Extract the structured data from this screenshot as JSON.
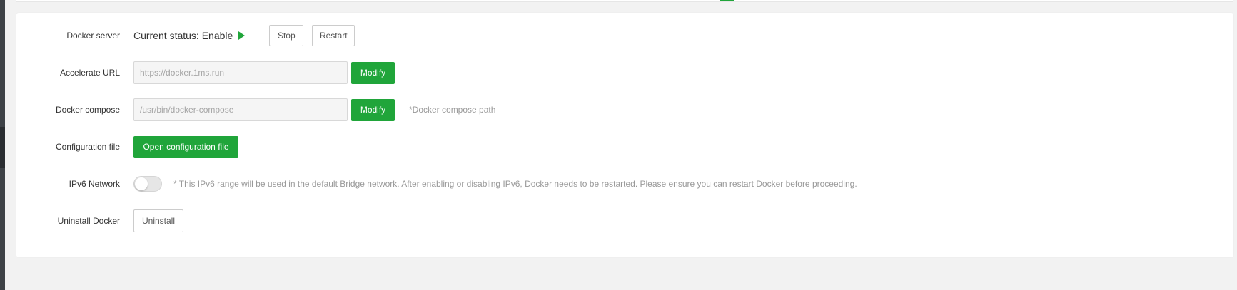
{
  "docker_server": {
    "label": "Docker server",
    "status_text": "Current status: Enable",
    "stop_label": "Stop",
    "restart_label": "Restart"
  },
  "accelerate_url": {
    "label": "Accelerate URL",
    "value": "",
    "placeholder": "https://docker.1ms.run",
    "modify_label": "Modify"
  },
  "docker_compose": {
    "label": "Docker compose",
    "value": "",
    "placeholder": "/usr/bin/docker-compose",
    "modify_label": "Modify",
    "hint": "*Docker compose path"
  },
  "configuration_file": {
    "label": "Configuration file",
    "open_label": "Open configuration file"
  },
  "ipv6_network": {
    "label": "IPv6 Network",
    "enabled": false,
    "hint": "* This IPv6 range will be used in the default Bridge network. After enabling or disabling IPv6, Docker needs to be restarted. Please ensure you can restart Docker before proceeding."
  },
  "uninstall_docker": {
    "label": "Uninstall Docker",
    "uninstall_label": "Uninstall"
  },
  "colors": {
    "accent_green": "#20a53a",
    "background": "#f2f2f2",
    "card": "#ffffff"
  }
}
